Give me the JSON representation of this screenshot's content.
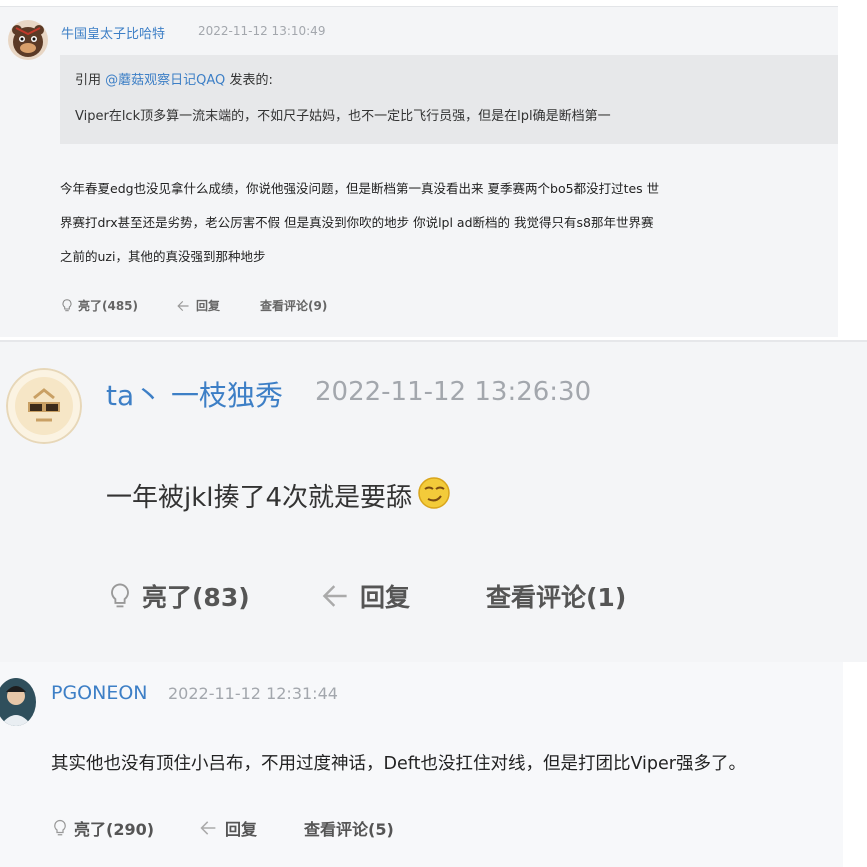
{
  "comments": [
    {
      "username": "牛国皇太子比哈特",
      "timestamp": "2022-11-12 13:10:49",
      "quote": {
        "prefix": "引用",
        "user": "@蘑菇观察日记QAQ",
        "suffix": "发表的:",
        "text": "Viper在lck顶多算一流末端的，不如尺子姑妈，也不一定比飞行员强，但是在lpl确是断档第一"
      },
      "body_lines": [
        "今年春夏edg也没见拿什么成绩，你说他强没问题，但是断档第一真没看出来  夏季赛两个bo5都没打过tes  世",
        "界赛打drx甚至还是劣势，老公厉害不假  但是真没到你吹的地步  你说lpl  ad断档的 我觉得只有s8那年世界赛",
        "之前的uzi，其他的真没强到那种地步"
      ],
      "like_label": "亮了(485)",
      "reply_label": "回复",
      "view_comments_label": "查看评论(9)"
    },
    {
      "username": "ta丶 一枝独秀",
      "timestamp": "2022-11-12 13:26:30",
      "body": "一年被jkl揍了4次就是要舔",
      "like_label": "亮了(83)",
      "reply_label": "回复",
      "view_comments_label": "查看评论(1)"
    },
    {
      "username": "PGONEON",
      "timestamp": "2022-11-12 12:31:44",
      "body": "其实他也没有顶住小吕布，不用过度神话，Deft也没扛住对线，但是打团比Viper强多了。",
      "like_label": "亮了(290)",
      "reply_label": "回复",
      "view_comments_label": "查看评论(5)"
    }
  ],
  "icons": {
    "like": "lightbulb-icon",
    "reply": "reply-arrow-icon",
    "emoji": "smirk-emoji-icon"
  },
  "colors": {
    "username": "#3d7fc6",
    "timestamp": "#a3a7ad",
    "card_background": "#f4f5f7",
    "quote_background": "#e7e8ea"
  }
}
